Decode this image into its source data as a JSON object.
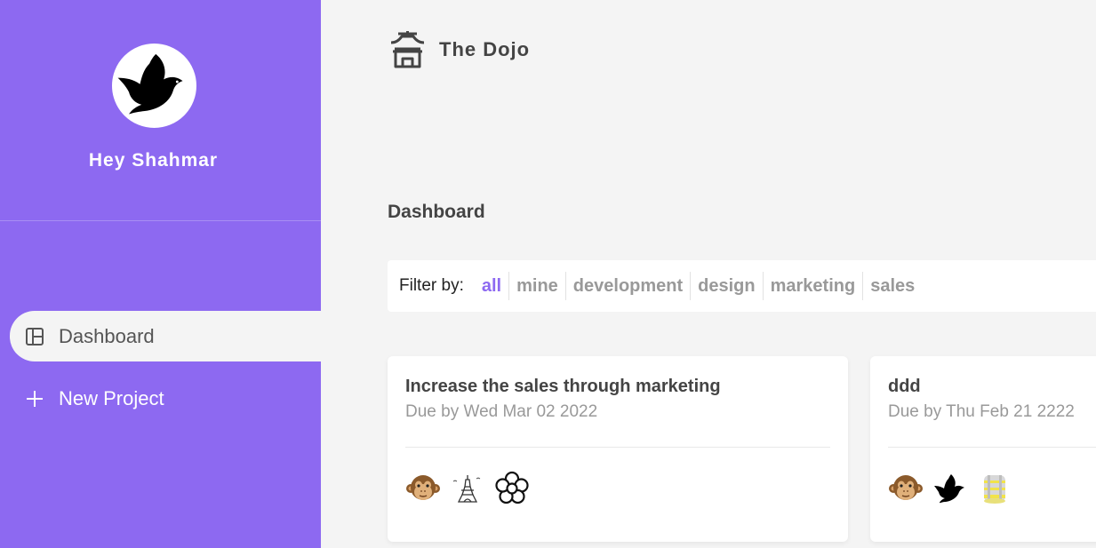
{
  "sidebar": {
    "avatar_icon": "dove-icon",
    "greeting": "Hey Shahmar",
    "nav": [
      {
        "label": "Dashboard",
        "icon": "dashboard-icon",
        "active": true
      },
      {
        "label": "New Project",
        "icon": "plus-icon",
        "active": false
      }
    ]
  },
  "topbar": {
    "logo_icon": "temple-icon",
    "title": "The Dojo"
  },
  "main": {
    "title": "Dashboard",
    "filter": {
      "label": "Filter by:",
      "options": [
        "all",
        "mine",
        "development",
        "design",
        "marketing",
        "sales"
      ],
      "selected": "all"
    },
    "projects": [
      {
        "name": "Increase the sales through marketing",
        "due": "Due by Wed Mar 02 2022",
        "assignees": [
          "monkey-avatar",
          "eiffel-tower-avatar",
          "flower-avatar"
        ]
      },
      {
        "name": "ddd",
        "due": "Due by Thu Feb 21 2222",
        "assignees": [
          "monkey-avatar",
          "dove-avatar",
          "cylinder-avatar"
        ]
      }
    ]
  },
  "colors": {
    "accent": "#8d69f1",
    "background": "#f4f4f4",
    "muted_text": "#999999"
  }
}
